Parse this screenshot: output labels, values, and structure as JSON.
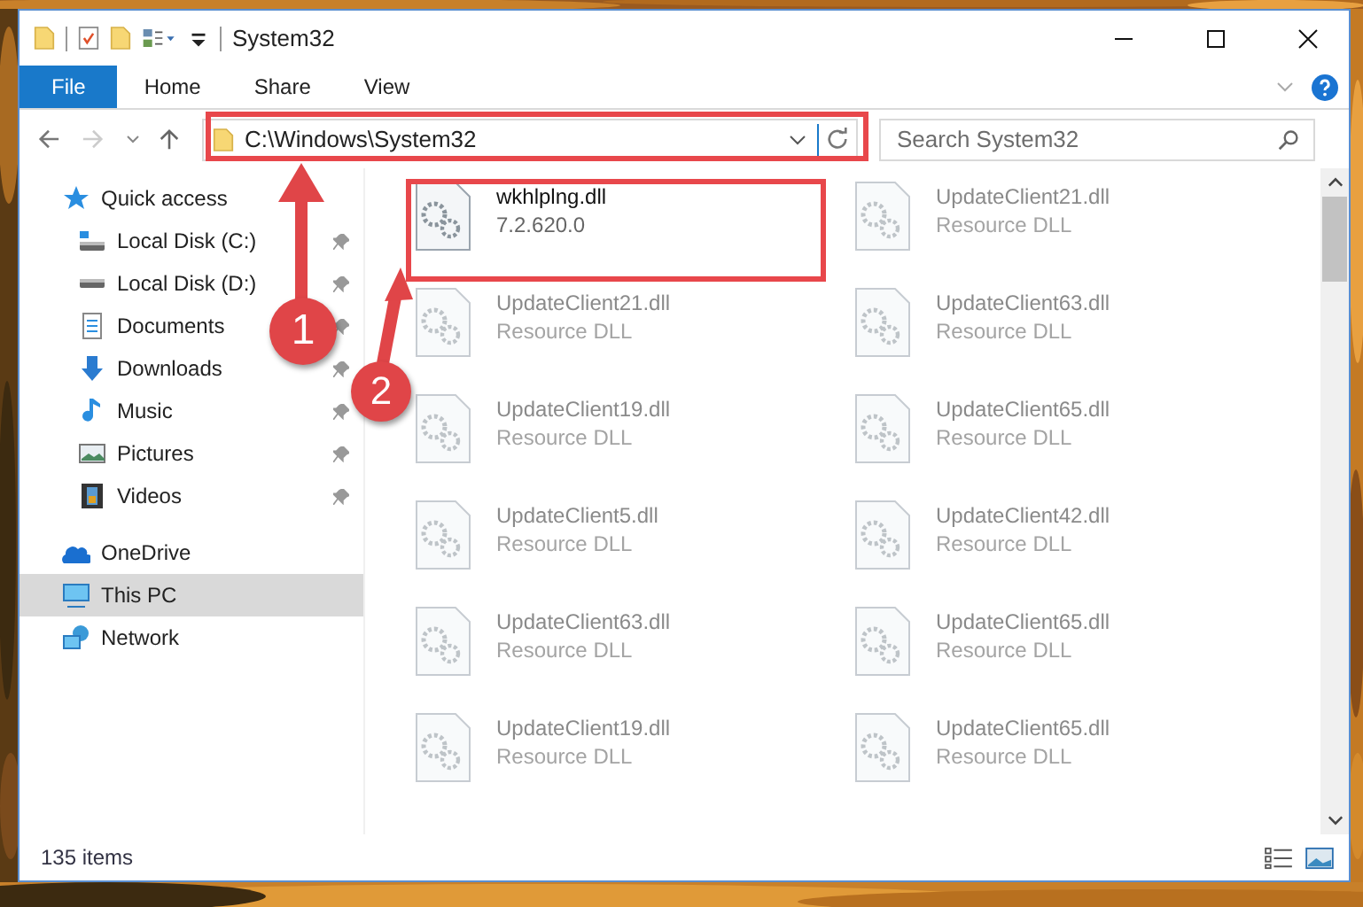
{
  "window": {
    "title": "System32"
  },
  "ribbon_tabs": [
    {
      "label": "File",
      "selected": true
    },
    {
      "label": "Home",
      "selected": false
    },
    {
      "label": "Share",
      "selected": false
    },
    {
      "label": "View",
      "selected": false
    }
  ],
  "address": {
    "path": "C:\\Windows\\System32"
  },
  "search": {
    "placeholder": "Search System32"
  },
  "sidebar": {
    "items": [
      {
        "label": "Quick access",
        "selected": false,
        "children": [
          {
            "label": "Local Disk (C:)",
            "pinned": true
          },
          {
            "label": "Local Disk (D:)",
            "pinned": true
          },
          {
            "label": "Documents",
            "pinned": true
          },
          {
            "label": "Downloads",
            "pinned": true
          },
          {
            "label": "Music",
            "pinned": true
          },
          {
            "label": "Pictures",
            "pinned": true
          },
          {
            "label": "Videos",
            "pinned": true
          }
        ]
      },
      {
        "label": "OneDrive",
        "selected": false
      },
      {
        "label": "This PC",
        "selected": true
      },
      {
        "label": "Network",
        "selected": false
      }
    ]
  },
  "files": [
    {
      "name": "wkhlplng.dll",
      "detail": "7.2.620.0",
      "faded": false
    },
    {
      "name": "UpdateClient21.dll",
      "detail": "Resource DLL",
      "faded": true
    },
    {
      "name": "UpdateClient21.dll",
      "detail": "Resource DLL",
      "faded": true
    },
    {
      "name": "UpdateClient63.dll",
      "detail": "Resource DLL",
      "faded": true
    },
    {
      "name": "UpdateClient19.dll",
      "detail": "Resource DLL",
      "faded": true
    },
    {
      "name": "UpdateClient65.dll",
      "detail": "Resource DLL",
      "faded": true
    },
    {
      "name": "UpdateClient5.dll",
      "detail": "Resource DLL",
      "faded": true
    },
    {
      "name": "UpdateClient42.dll",
      "detail": "Resource DLL",
      "faded": true
    },
    {
      "name": "UpdateClient63.dll",
      "detail": "Resource DLL",
      "faded": true
    },
    {
      "name": "UpdateClient65.dll",
      "detail": "Resource DLL",
      "faded": true
    },
    {
      "name": "UpdateClient19.dll",
      "detail": "Resource DLL",
      "faded": true
    },
    {
      "name": "UpdateClient65.dll",
      "detail": "Resource DLL",
      "faded": true
    }
  ],
  "status_bar": {
    "count": "135 items"
  },
  "annotations": [
    {
      "label": "1"
    },
    {
      "label": "2"
    }
  ]
}
